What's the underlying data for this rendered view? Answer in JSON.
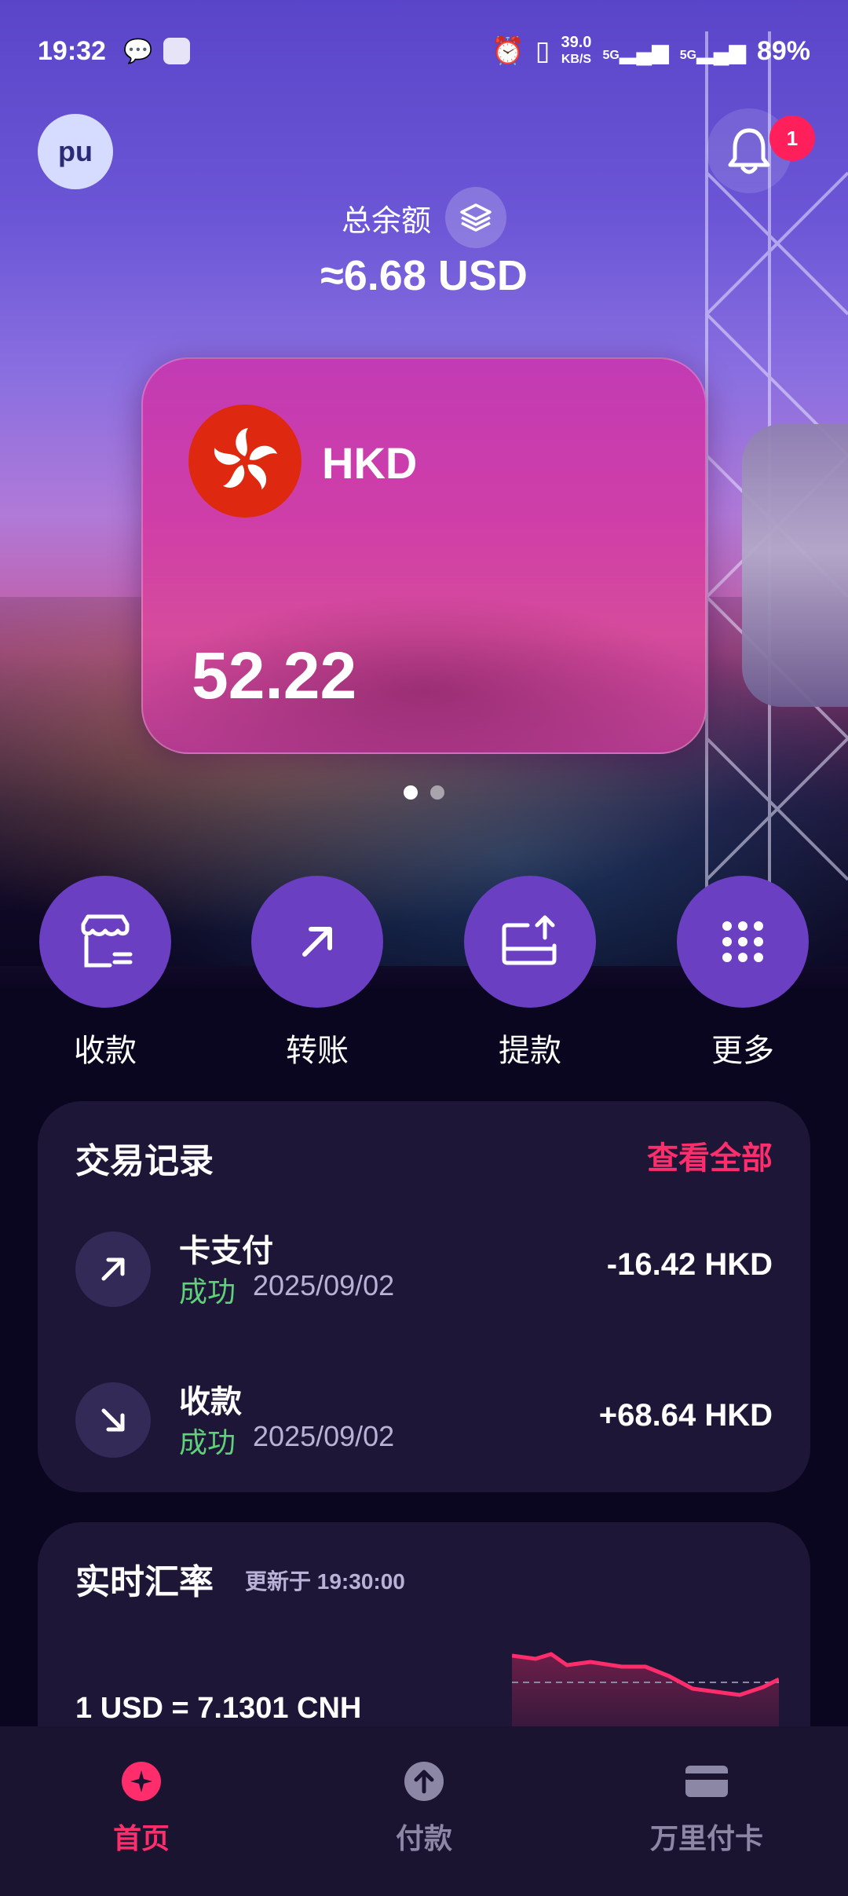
{
  "status_bar": {
    "time": "19:32",
    "net_speed_value": "39.0",
    "net_speed_unit": "KB/S",
    "network_1": "5G",
    "network_2": "5G",
    "battery": "89%"
  },
  "header": {
    "avatar_initials": "pu",
    "notification_count": "1",
    "total_label": "总余额",
    "total_amount": "≈6.68 USD"
  },
  "card": {
    "currency": "HKD",
    "balance": "52.22",
    "page_count": 2,
    "active_page": 1
  },
  "actions": [
    {
      "label": "收款",
      "icon": "store-receive-icon"
    },
    {
      "label": "转账",
      "icon": "arrow-up-right-icon"
    },
    {
      "label": "提款",
      "icon": "withdraw-icon"
    },
    {
      "label": "更多",
      "icon": "grid-dots-icon"
    }
  ],
  "transactions": {
    "title": "交易记录",
    "view_all": "查看全部",
    "items": [
      {
        "name": "卡支付",
        "status": "成功",
        "date": "2025/09/02",
        "amount": "-16.42 HKD",
        "direction": "out"
      },
      {
        "name": "收款",
        "status": "成功",
        "date": "2025/09/02",
        "amount": "+68.64 HKD",
        "direction": "in"
      }
    ]
  },
  "rates": {
    "title": "实时汇率",
    "updated": "更新于 19:30:00",
    "pair": "1 USD = 7.1301 CNH"
  },
  "bottom_nav": [
    {
      "label": "首页",
      "icon": "home-star-icon",
      "active": true
    },
    {
      "label": "付款",
      "icon": "pay-arrow-icon",
      "active": false
    },
    {
      "label": "万里付卡",
      "icon": "card-icon",
      "active": false
    }
  ],
  "colors": {
    "accent": "#ff2d6b",
    "success": "#5ed17a",
    "action_circle": "#6a3fc2",
    "panel": "#1d1636"
  }
}
